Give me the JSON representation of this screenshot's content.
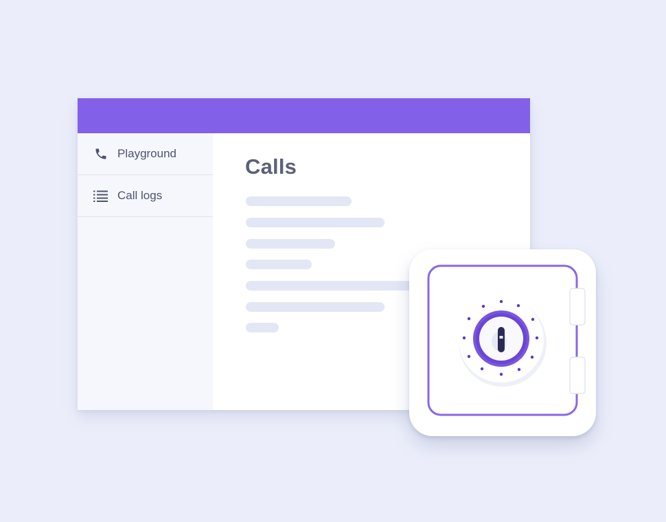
{
  "sidebar": {
    "items": [
      {
        "label": "Playground",
        "icon": "phone-icon"
      },
      {
        "label": "Call logs",
        "icon": "list-icon"
      }
    ]
  },
  "main": {
    "title": "Calls"
  },
  "colors": {
    "accent": "#8261e8",
    "page_background": "#ebeefa",
    "skeleton": "#e3e6f5",
    "text": "#4d5371",
    "safe_dial": "#6c45d6",
    "keyhole": "#2b2a57"
  },
  "illustration": {
    "icon": "safe-vault-icon"
  }
}
